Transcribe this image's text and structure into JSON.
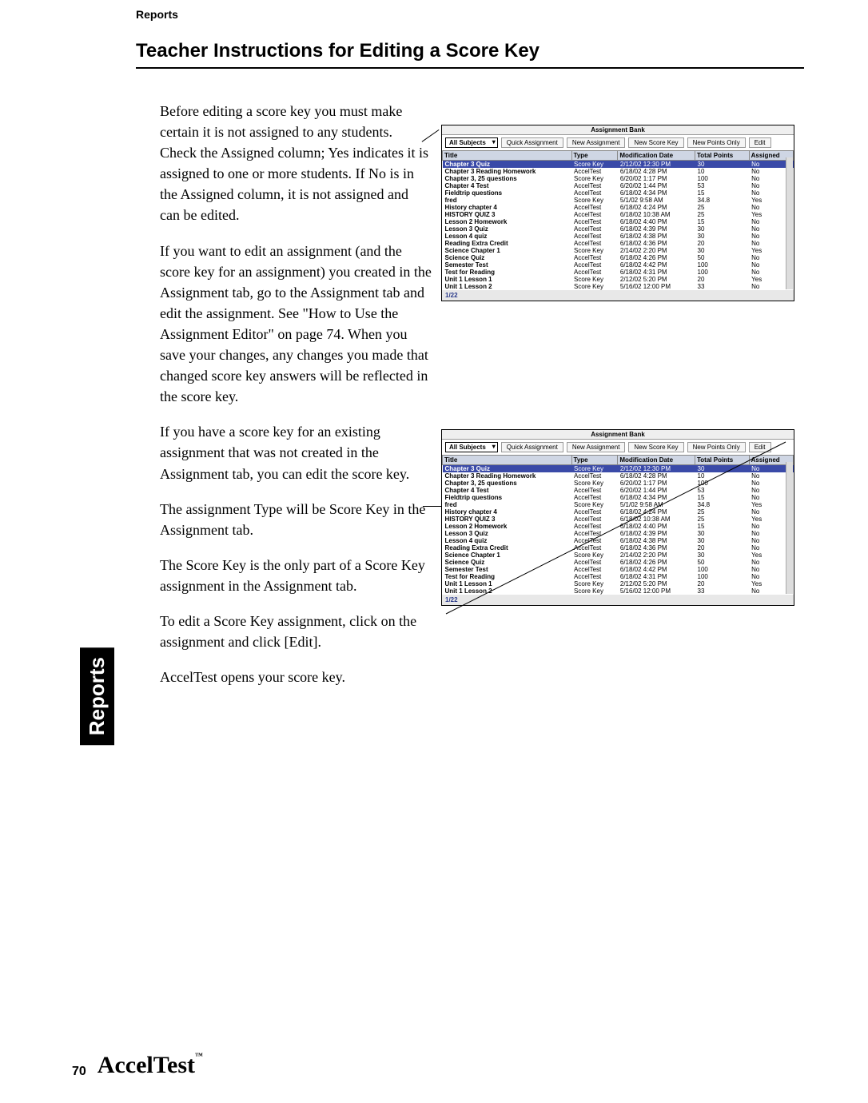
{
  "running_head": "Reports",
  "section_title": "Teacher Instructions for Editing a Score Key",
  "side_tab": "Reports",
  "page_number": "70",
  "brand": "AccelTest",
  "brand_tm": "™",
  "paragraphs": {
    "p1": "Before editing a score key you must make certain it is not assigned to any students. Check the Assigned column; Yes indicates it is assigned to one or more students. If No is in the Assigned column, it is not assigned and can be edited.",
    "p2": "If you want to edit an assignment (and the score key for an assignment) you created in the Assignment tab, go to the Assignment tab and edit the assignment. See \"How to Use the Assignment Editor\" on page 74. When you save your changes, any changes you made that changed score key answers will be reflected in the score key.",
    "p3": "If you have a score key for an existing assignment that was not created in the Assignment tab, you can edit the score key.",
    "p4": "The assignment Type will be Score Key in the Assignment tab.",
    "p5": "The Score Key is the only part of a Score Key assignment in the Assignment tab.",
    "p6": "To edit a Score Key assignment, click on the assignment and click [Edit].",
    "p7": "AccelTest opens your score key."
  },
  "screenshot": {
    "window_title": "Assignment Bank",
    "subject_select": "All Subjects",
    "buttons": {
      "quick": "Quick Assignment",
      "newasg": "New Assignment",
      "newscore": "New Score Key",
      "newpts": "New Points Only",
      "edit": "Edit"
    },
    "columns": {
      "title": "Title",
      "type": "Type",
      "mod": "Modification Date",
      "pts": "Total Points",
      "asg": "Assigned"
    },
    "status": "1/22",
    "rows": [
      {
        "title": "Chapter 3 Quiz",
        "type": "Score Key",
        "mod": "2/12/02 12:30 PM",
        "pts": "30",
        "asg": "No"
      },
      {
        "title": "Chapter 3 Reading Homework",
        "type": "AccelTest",
        "mod": "6/18/02 4:28 PM",
        "pts": "10",
        "asg": "No"
      },
      {
        "title": "Chapter 3, 25 questions",
        "type": "Score Key",
        "mod": "6/20/02 1:17 PM",
        "pts": "100",
        "asg": "No"
      },
      {
        "title": "Chapter 4 Test",
        "type": "AccelTest",
        "mod": "6/20/02 1:44 PM",
        "pts": "53",
        "asg": "No"
      },
      {
        "title": "Fieldtrip questions",
        "type": "AccelTest",
        "mod": "6/18/02 4:34 PM",
        "pts": "15",
        "asg": "No"
      },
      {
        "title": "fred",
        "type": "Score Key",
        "mod": "5/1/02 9:58 AM",
        "pts": "34.8",
        "asg": "Yes"
      },
      {
        "title": "History chapter 4",
        "type": "AccelTest",
        "mod": "6/18/02 4:24 PM",
        "pts": "25",
        "asg": "No"
      },
      {
        "title": "HISTORY QUIZ 3",
        "type": "AccelTest",
        "mod": "6/18/02 10:38 AM",
        "pts": "25",
        "asg": "Yes"
      },
      {
        "title": "Lesson 2 Homework",
        "type": "AccelTest",
        "mod": "6/18/02 4:40 PM",
        "pts": "15",
        "asg": "No"
      },
      {
        "title": "Lesson 3 Quiz",
        "type": "AccelTest",
        "mod": "6/18/02 4:39 PM",
        "pts": "30",
        "asg": "No"
      },
      {
        "title": "Lesson 4 quiz",
        "type": "AccelTest",
        "mod": "6/18/02 4:38 PM",
        "pts": "30",
        "asg": "No"
      },
      {
        "title": "Reading Extra Credit",
        "type": "AccelTest",
        "mod": "6/18/02 4:36 PM",
        "pts": "20",
        "asg": "No"
      },
      {
        "title": "Science Chapter 1",
        "type": "Score Key",
        "mod": "2/14/02 2:20 PM",
        "pts": "30",
        "asg": "Yes"
      },
      {
        "title": "Science Quiz",
        "type": "AccelTest",
        "mod": "6/18/02 4:26 PM",
        "pts": "50",
        "asg": "No"
      },
      {
        "title": "Semester Test",
        "type": "AccelTest",
        "mod": "6/18/02 4:42 PM",
        "pts": "100",
        "asg": "No"
      },
      {
        "title": "Test for Reading",
        "type": "AccelTest",
        "mod": "6/18/02 4:31 PM",
        "pts": "100",
        "asg": "No"
      },
      {
        "title": "Unit 1 Lesson 1",
        "type": "Score Key",
        "mod": "2/12/02 5:20 PM",
        "pts": "20",
        "asg": "Yes"
      },
      {
        "title": "Unit 1 Lesson 2",
        "type": "Score Key",
        "mod": "5/16/02 12:00 PM",
        "pts": "33",
        "asg": "No"
      }
    ]
  }
}
